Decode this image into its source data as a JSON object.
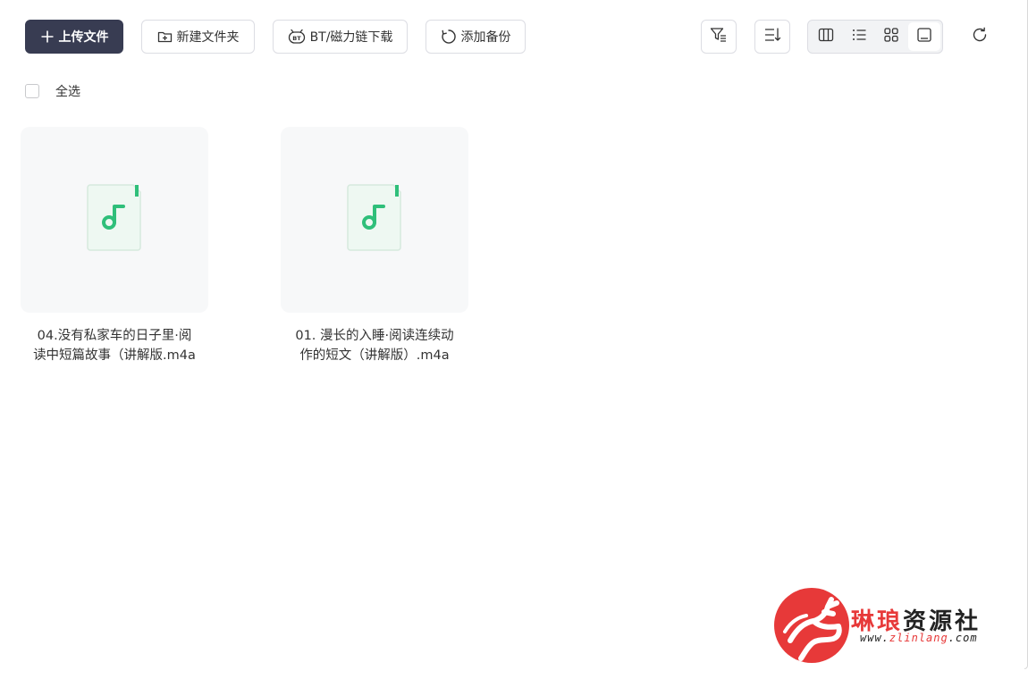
{
  "toolbar": {
    "upload_label": "上传文件",
    "new_folder_label": "新建文件夹",
    "bt_label": "BT/磁力链下载",
    "bt_icon_text": "BT",
    "backup_label": "添加备份"
  },
  "selection": {
    "select_all_label": "全选"
  },
  "files": [
    {
      "name_line1": "04.没有私家车的日子里·阅",
      "name_line2": "读中短篇故事（讲解版.m4a",
      "type": "audio-file-icon"
    },
    {
      "name_line1": "01. 漫长的入睡·阅读连续动",
      "name_line2": "作的短文（讲解版）.m4a",
      "type": "audio-file-icon"
    }
  ],
  "watermark": {
    "brand_red": "琳琅",
    "brand_black": "资源社",
    "url_red": "zlinlang",
    "url_black": ".com"
  },
  "colors": {
    "primary": "#383c52",
    "file_icon_green": "#2fbf7a",
    "watermark_red": "#e73939"
  }
}
